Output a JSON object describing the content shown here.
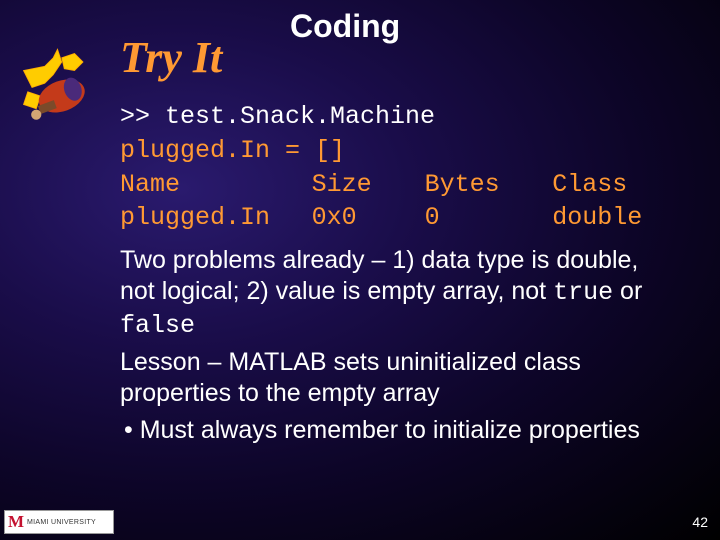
{
  "header": {
    "title": "Coding",
    "subtitle": "Try It"
  },
  "code": {
    "prompt": ">> ",
    "command": "test.Snack.Machine",
    "line2": "plugged.In = []",
    "headers": {
      "name": "Name",
      "size": "Size",
      "bytes": "Bytes",
      "class": "Class"
    },
    "row": {
      "name": "plugged.In",
      "size": "0x0",
      "bytes": "0",
      "class": "double"
    }
  },
  "para1_a": "Two problems already – 1) data type is double, not logical; 2) value is empty array, not ",
  "para1_true": "true",
  "para1_or": " or ",
  "para1_false": "false",
  "para2": "Lesson – MATLAB sets uninitialized class properties to the empty array",
  "bullet1": "• Must always remember to initialize properties",
  "pagenum": "42",
  "logo": {
    "letter": "M",
    "text": "MIAMI UNIVERSITY"
  }
}
